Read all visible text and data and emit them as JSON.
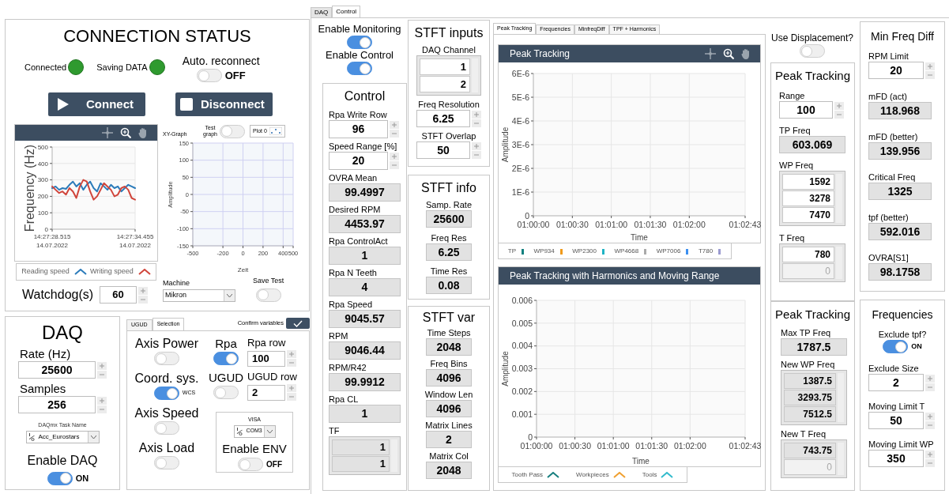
{
  "connection_status": {
    "title": "CONNECTION STATUS",
    "leds": [
      {
        "label": "Connected",
        "on": true
      },
      {
        "label": "Saving DATA",
        "on": true
      }
    ],
    "auto_reconnect": {
      "label": "Auto. reconnect",
      "on": false,
      "state_text": "OFF"
    },
    "buttons": [
      {
        "kind": "play",
        "label": "Connect"
      },
      {
        "kind": "stop",
        "label": "Disconnect"
      }
    ],
    "frequency_chart": {
      "chart_data": {
        "type": "line",
        "grid": true,
        "ylabel": "Frequency (Hz)",
        "categories": [
          "14:27:28.515 14.07.2022",
          null,
          null,
          null,
          null,
          null,
          null,
          null,
          null,
          null,
          null,
          null,
          null,
          null,
          null,
          null,
          null,
          null,
          null,
          null,
          null,
          null,
          null,
          null,
          "14:27:34.455 14.07.2022"
        ],
        "ylim": [
          0,
          500
        ],
        "yticks": [
          0,
          100,
          200,
          300,
          400,
          500
        ],
        "series": [
          {
            "name": "Reading speed",
            "color": "#2b7bba",
            "values": [
              250,
              260,
              240,
              250,
              245,
              270,
              290,
              260,
              280,
              240,
              270,
              290,
              250,
              230,
              280,
              260,
              240,
              270,
              250,
              260,
              230,
              250,
              270,
              260,
              250
            ]
          },
          {
            "name": "Writing speed",
            "color": "#d0453b",
            "values": [
              260,
              240,
              220,
              230,
              210,
              250,
              230,
              190,
              260,
              300,
              290,
              230,
              180,
              200,
              240,
              280,
              260,
              240,
              200,
              210,
              250,
              260,
              240,
              190,
              180
            ]
          }
        ]
      }
    },
    "watchdog": {
      "label": "Watchdog(s)",
      "value": "60"
    },
    "xy_graph": {
      "label": "XY-Graph",
      "test_graph": {
        "label": "Test graph",
        "on": false
      },
      "plot_legend": "Plot 0",
      "chart_data": {
        "type": "scatter",
        "grid": true,
        "xlabel": "Zeit",
        "ylabel": "Amplitude",
        "xlim": [
          -500,
          500
        ],
        "ylim": [
          -150,
          150
        ],
        "xticks": [
          -500,
          -200,
          0,
          200,
          400,
          500
        ],
        "yticks": [
          -150,
          -100,
          -50,
          0,
          50,
          100,
          150
        ]
      }
    },
    "machine": {
      "label": "Machine",
      "value": "Mikron"
    },
    "save_test": {
      "label": "Save Test",
      "on": false
    }
  },
  "daq": {
    "title": "DAQ",
    "rate": {
      "label": "Rate (Hz)",
      "value": "25600"
    },
    "samples": {
      "label": "Samples",
      "value": "256"
    },
    "task": {
      "label": "DAQmx Task Name",
      "value": "Acc_Eurostars"
    },
    "enable": {
      "label": "Enable DAQ",
      "on": true,
      "state_text": "ON"
    }
  },
  "variables": {
    "tabs": [
      {
        "label": "UGUD",
        "selected": false
      },
      {
        "label": "Selection",
        "selected": true
      }
    ],
    "confirm_label": "Confirm variables",
    "axis_power": {
      "label": "Axis Power",
      "on": false
    },
    "coord_sys": {
      "label": "Coord. sys.",
      "on": true,
      "state_text": "WCS"
    },
    "axis_speed": {
      "label": "Axis Speed",
      "on": false
    },
    "axis_load": {
      "label": "Axis Load",
      "on": false
    },
    "rpa": {
      "label": "Rpa",
      "on": true
    },
    "ugud": {
      "label": "UGUD",
      "on": false
    },
    "rpa_row": {
      "label": "Rpa row",
      "value": "100"
    },
    "ugud_row": {
      "label": "UGUD row",
      "value": "2"
    },
    "visa": {
      "label": "VISA",
      "value": "COM3"
    },
    "enable_env": {
      "label": "Enable ENV",
      "on": false,
      "state_text": "OFF"
    }
  },
  "main_tabs": [
    {
      "label": "DAQ",
      "selected": false
    },
    {
      "label": "Control",
      "selected": true
    }
  ],
  "monitoring": [
    {
      "label": "Enable Monitoring",
      "on": true
    },
    {
      "label": "Enable Control",
      "on": true
    }
  ],
  "control": {
    "title": "Control",
    "fields": [
      {
        "kind": "numeric",
        "label": "Rpa Write Row",
        "value": "96"
      },
      {
        "kind": "numeric",
        "label": "Speed Range [%]",
        "value": "20"
      },
      {
        "kind": "indicator",
        "label": "OVRA Mean",
        "value": "99.4997"
      },
      {
        "kind": "indicator",
        "label": "Desired RPM",
        "value": "4453.97"
      },
      {
        "kind": "indicator",
        "label": "Rpa ControlAct",
        "value": "1"
      },
      {
        "kind": "indicator",
        "label": "Rpa N Teeth",
        "value": "4"
      },
      {
        "kind": "indicator",
        "label": "Rpa Speed",
        "value": "9045.57"
      },
      {
        "kind": "indicator",
        "label": "RPM",
        "value": "9046.44"
      },
      {
        "kind": "indicator",
        "label": "RPM/R42",
        "value": "99.9912"
      },
      {
        "kind": "indicator",
        "label": "Rpa CL",
        "value": "1"
      },
      {
        "kind": "array",
        "label": "TF",
        "indicator": true,
        "items": [
          {
            "value": "1",
            "empty": false
          },
          {
            "value": "1",
            "empty": false
          }
        ]
      }
    ]
  },
  "stft_inputs": {
    "title": "STFT inputs",
    "fields": [
      {
        "kind": "array",
        "label": "DAQ Channel",
        "indicator": false,
        "items": [
          {
            "value": "1",
            "empty": false
          },
          {
            "value": "2",
            "empty": false
          }
        ]
      },
      {
        "kind": "numeric",
        "label": "Freq Resolution",
        "value": "6.25"
      },
      {
        "kind": "numeric",
        "label": "STFT Overlap",
        "value": "50"
      }
    ]
  },
  "stft_info": {
    "title": "STFT info",
    "fields": [
      {
        "kind": "indicator",
        "label": "Samp. Rate",
        "value": "25600"
      },
      {
        "kind": "indicator",
        "label": "Freq Res",
        "value": "6.25"
      },
      {
        "kind": "indicator",
        "label": "Time Res",
        "value": "0.08"
      }
    ]
  },
  "stft_var": {
    "title": "STFT var",
    "fields": [
      {
        "kind": "indicator",
        "label": "Time Steps",
        "value": "2048"
      },
      {
        "kind": "indicator",
        "label": "Freq Bins",
        "value": "4096"
      },
      {
        "kind": "indicator",
        "label": "Window Len",
        "value": "4096"
      },
      {
        "kind": "indicator",
        "label": "Matrix Lines",
        "value": "2"
      },
      {
        "kind": "indicator",
        "label": "Matrix Col",
        "value": "2048"
      }
    ]
  },
  "chart_tabs": [
    {
      "label": "Peak Tracking",
      "selected": true
    },
    {
      "label": "Frequencies",
      "selected": false
    },
    {
      "label": "MinfreqDiff",
      "selected": false
    },
    {
      "label": "TPF + Harmonics",
      "selected": false
    }
  ],
  "peak_chart": {
    "title": "Peak Tracking",
    "chart_data": {
      "type": "line",
      "grid": true,
      "xlabel": "Time",
      "ylabel": "Amplitude",
      "xlim": [
        3600,
        3763
      ],
      "ylim": [
        0,
        6e-06
      ],
      "xticks": [
        {
          "value": 3600,
          "label": "01:00:00"
        },
        {
          "value": 3630,
          "label": "01:00:30"
        },
        {
          "value": 3660,
          "label": "01:01:00"
        },
        {
          "value": 3690,
          "label": "01:01:30"
        },
        {
          "value": 3720,
          "label": "01:02:00"
        },
        {
          "value": 3763,
          "label": "01:02:43"
        }
      ],
      "yticks": [
        {
          "value": 0,
          "label": "0"
        },
        {
          "value": 1e-06,
          "label": "1E-6"
        },
        {
          "value": 2e-06,
          "label": "2E-6"
        },
        {
          "value": 3e-06,
          "label": "3E-6"
        },
        {
          "value": 4e-06,
          "label": "4E-6"
        },
        {
          "value": 5e-06,
          "label": "5E-6"
        },
        {
          "value": 6e-06,
          "label": "6E-6"
        }
      ]
    },
    "legend": [
      {
        "name": "TP",
        "color": "#12807f"
      },
      {
        "name": "WP934",
        "color": "#f09a1a"
      },
      {
        "name": "WP2300",
        "color": "#1fb3c4"
      },
      {
        "name": "WP4668",
        "color": "#aaaaaa"
      },
      {
        "name": "WP7006",
        "color": "#3b8ff0"
      },
      {
        "name": "T780",
        "color": "#9a9ad0"
      }
    ]
  },
  "harmonics_chart": {
    "title": "Peak Tracking with Harmonics and Moving Range",
    "chart_data": {
      "type": "line",
      "grid": true,
      "xlabel": "Time",
      "ylabel": "Amplitude",
      "xlim": [
        3600,
        3763
      ],
      "ylim": [
        0,
        0.006
      ],
      "xticks": [
        {
          "value": 3600,
          "label": "01:00:00"
        },
        {
          "value": 3630,
          "label": "01:00:30"
        },
        {
          "value": 3660,
          "label": "01:01:00"
        },
        {
          "value": 3690,
          "label": "01:01:30"
        },
        {
          "value": 3720,
          "label": "01:02:00"
        },
        {
          "value": 3763,
          "label": "01:02:43"
        }
      ],
      "yticks": [
        {
          "value": 0,
          "label": "0"
        },
        {
          "value": 0.001,
          "label": "0.001"
        },
        {
          "value": 0.002,
          "label": "0.002"
        },
        {
          "value": 0.003,
          "label": "0.003"
        },
        {
          "value": 0.004,
          "label": "0.004"
        },
        {
          "value": 0.005,
          "label": "0.005"
        },
        {
          "value": 0.006,
          "label": "0.006"
        }
      ]
    },
    "legend": [
      {
        "name": "Tooth Pass",
        "color": "#177f7f"
      },
      {
        "name": "Workpieces",
        "color": "#f0a030"
      },
      {
        "name": "Tools",
        "color": "#33bbcc"
      }
    ]
  },
  "use_displacement": {
    "label": "Use Displacement?",
    "on": false
  },
  "peak_tracking": {
    "title": "Peak Tracking",
    "fields": [
      {
        "kind": "numeric",
        "label": "Range",
        "value": "100"
      },
      {
        "kind": "indicator",
        "label": "TP Freq",
        "value": "603.069"
      },
      {
        "kind": "array",
        "label": "WP Freq",
        "indicator": false,
        "items": [
          {
            "value": "1592",
            "empty": false
          },
          {
            "value": "3278",
            "empty": false
          },
          {
            "value": "7470",
            "empty": false
          }
        ]
      },
      {
        "kind": "array",
        "label": "T Freq",
        "indicator": false,
        "items": [
          {
            "value": "780",
            "empty": false
          },
          {
            "value": "0",
            "empty": true
          }
        ]
      }
    ]
  },
  "min_freq_diff": {
    "title": "Min Freq Diff",
    "fields": [
      {
        "kind": "numeric",
        "label": "RPM Limit",
        "value": "20"
      },
      {
        "kind": "indicator",
        "label": "mFD (act)",
        "value": "118.968"
      },
      {
        "kind": "indicator",
        "label": "mFD (better)",
        "value": "139.956"
      },
      {
        "kind": "indicator",
        "label": "Critical Freq",
        "value": "1325"
      },
      {
        "kind": "indicator",
        "label": "tpf (better)",
        "value": "592.016"
      },
      {
        "kind": "indicator",
        "label": "OVRA[S1]",
        "value": "98.1758"
      }
    ]
  },
  "peak_tracking_new": {
    "title": "Peak Tracking",
    "fields": [
      {
        "kind": "indicator",
        "label": "Max TP Freq",
        "value": "1787.5"
      },
      {
        "kind": "array",
        "label": "New WP Freq",
        "indicator": true,
        "items": [
          {
            "value": "1387.5",
            "empty": false
          },
          {
            "value": "3293.75",
            "empty": false
          },
          {
            "value": "7512.5",
            "empty": false
          }
        ]
      },
      {
        "kind": "array",
        "label": "New T Freq",
        "indicator": true,
        "items": [
          {
            "value": "743.75",
            "empty": false
          },
          {
            "value": "0",
            "empty": true
          }
        ]
      }
    ]
  },
  "frequencies": {
    "title": "Frequencies",
    "fields": [
      {
        "kind": "toggle",
        "label": "Exclude tpf?",
        "on": true,
        "state_text": "ON"
      },
      {
        "kind": "numeric",
        "label": "Exclude Size",
        "value": "2"
      },
      {
        "kind": "numeric",
        "label": "Moving Limit T",
        "value": "50"
      },
      {
        "kind": "numeric",
        "label": "Moving Limit WP",
        "value": "350"
      }
    ]
  }
}
